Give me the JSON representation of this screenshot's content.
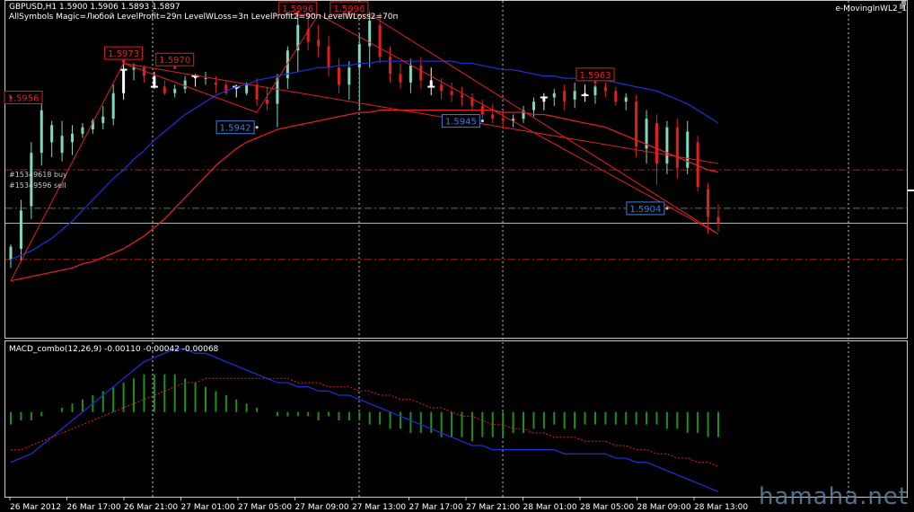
{
  "header": {
    "symbol_line": "GBPUSD,H1  1.5900 1.5906 1.5893 1.5897",
    "settings_line": "AllSymbols  Magic=Любой  LevelProfit=29п  LevelWLoss=3п  LevelProfit2=90п  LevelWLoss2=70п",
    "expert_name": "e-MovingInWL2_1"
  },
  "orders": [
    {
      "label": "#15349618 buy"
    },
    {
      "label": "#15349596 sell"
    }
  ],
  "watermark": "hamaha.net",
  "colors": {
    "bull_candle": "#7fd8c0",
    "bear_candle": "#e02020",
    "ma_fast": "#1a2fd0",
    "ma_slow": "#e02020",
    "zigzag": "#e02020",
    "macd_line": "#1a2fd0",
    "macd_signal": "#e02020",
    "macd_hist": "#1f8f1f",
    "high_label": "#e02020",
    "low_label": "#3a7fe0",
    "level_red": "#c01818",
    "level_green": "#3b8a3b",
    "level_grey": "#b0b0b0",
    "grid": "#c8c8c8"
  },
  "chart_data": [
    {
      "type": "candlestick",
      "title": "GBPUSD,H1",
      "ylim": [
        1.5845,
        1.6
      ],
      "x_tick_labels": [
        "26 Mar 2012",
        "26 Mar 17:00",
        "26 Mar 21:00",
        "27 Mar 01:00",
        "27 Mar 05:00",
        "27 Mar 09:00",
        "27 Mar 13:00",
        "27 Mar 17:00",
        "27 Mar 21:00",
        "28 Mar 01:00",
        "28 Mar 05:00",
        "28 Mar 09:00",
        "28 Mar 13:00"
      ],
      "candles": [
        {
          "o": 1.588,
          "h": 1.5887,
          "l": 1.5876,
          "c": 1.5886
        },
        {
          "o": 1.5885,
          "h": 1.5908,
          "l": 1.5879,
          "c": 1.5903
        },
        {
          "o": 1.5905,
          "h": 1.5935,
          "l": 1.5899,
          "c": 1.593
        },
        {
          "o": 1.593,
          "h": 1.5957,
          "l": 1.5924,
          "c": 1.595
        },
        {
          "o": 1.5935,
          "h": 1.5945,
          "l": 1.5928,
          "c": 1.5943
        },
        {
          "o": 1.593,
          "h": 1.5945,
          "l": 1.5926,
          "c": 1.5938
        },
        {
          "o": 1.5935,
          "h": 1.5943,
          "l": 1.5929,
          "c": 1.5939
        },
        {
          "o": 1.5939,
          "h": 1.5944,
          "l": 1.5937,
          "c": 1.5942
        },
        {
          "o": 1.5941,
          "h": 1.5946,
          "l": 1.5939,
          "c": 1.5945
        },
        {
          "o": 1.5944,
          "h": 1.5952,
          "l": 1.5941,
          "c": 1.5947
        },
        {
          "o": 1.5946,
          "h": 1.5962,
          "l": 1.5943,
          "c": 1.5958
        },
        {
          "o": 1.5958,
          "h": 1.5973,
          "l": 1.5955,
          "c": 1.5969
        },
        {
          "o": 1.5969,
          "h": 1.5972,
          "l": 1.5964,
          "c": 1.597
        },
        {
          "o": 1.597,
          "h": 1.5971,
          "l": 1.5963,
          "c": 1.5966
        },
        {
          "o": 1.5966,
          "h": 1.5968,
          "l": 1.596,
          "c": 1.5961
        },
        {
          "o": 1.5961,
          "h": 1.5964,
          "l": 1.5957,
          "c": 1.5958
        },
        {
          "o": 1.5958,
          "h": 1.5962,
          "l": 1.5956,
          "c": 1.596
        },
        {
          "o": 1.596,
          "h": 1.5966,
          "l": 1.5958,
          "c": 1.5964
        },
        {
          "o": 1.5965,
          "h": 1.5967,
          "l": 1.5961,
          "c": 1.5966
        },
        {
          "o": 1.5965,
          "h": 1.5968,
          "l": 1.5962,
          "c": 1.5965
        },
        {
          "o": 1.5963,
          "h": 1.5966,
          "l": 1.5958,
          "c": 1.5962
        },
        {
          "o": 1.5962,
          "h": 1.5964,
          "l": 1.5957,
          "c": 1.5958
        },
        {
          "o": 1.596,
          "h": 1.5962,
          "l": 1.5956,
          "c": 1.5961
        },
        {
          "o": 1.5958,
          "h": 1.5963,
          "l": 1.5957,
          "c": 1.5962
        },
        {
          "o": 1.5962,
          "h": 1.5965,
          "l": 1.5952,
          "c": 1.5955
        },
        {
          "o": 1.5955,
          "h": 1.5961,
          "l": 1.595,
          "c": 1.5953
        },
        {
          "o": 1.5953,
          "h": 1.5967,
          "l": 1.5942,
          "c": 1.5965
        },
        {
          "o": 1.5965,
          "h": 1.598,
          "l": 1.596,
          "c": 1.5978
        },
        {
          "o": 1.5978,
          "h": 1.5996,
          "l": 1.5968,
          "c": 1.599
        },
        {
          "o": 1.5988,
          "h": 1.5994,
          "l": 1.5978,
          "c": 1.5982
        },
        {
          "o": 1.5983,
          "h": 1.599,
          "l": 1.5975,
          "c": 1.598
        },
        {
          "o": 1.598,
          "h": 1.5985,
          "l": 1.5966,
          "c": 1.597
        },
        {
          "o": 1.597,
          "h": 1.5974,
          "l": 1.5958,
          "c": 1.5962
        },
        {
          "o": 1.5962,
          "h": 1.5973,
          "l": 1.5955,
          "c": 1.597
        },
        {
          "o": 1.597,
          "h": 1.5986,
          "l": 1.595,
          "c": 1.5981
        },
        {
          "o": 1.598,
          "h": 1.5996,
          "l": 1.597,
          "c": 1.5992
        },
        {
          "o": 1.599,
          "h": 1.5996,
          "l": 1.5972,
          "c": 1.5975
        },
        {
          "o": 1.5975,
          "h": 1.598,
          "l": 1.5963,
          "c": 1.5967
        },
        {
          "o": 1.5967,
          "h": 1.5972,
          "l": 1.596,
          "c": 1.5963
        },
        {
          "o": 1.5963,
          "h": 1.5974,
          "l": 1.5958,
          "c": 1.5971
        },
        {
          "o": 1.5971,
          "h": 1.5975,
          "l": 1.596,
          "c": 1.5964
        },
        {
          "o": 1.5964,
          "h": 1.597,
          "l": 1.5957,
          "c": 1.5961
        },
        {
          "o": 1.5962,
          "h": 1.5965,
          "l": 1.5955,
          "c": 1.5959
        },
        {
          "o": 1.5959,
          "h": 1.5963,
          "l": 1.5954,
          "c": 1.5957
        },
        {
          "o": 1.5957,
          "h": 1.5961,
          "l": 1.5952,
          "c": 1.5956
        },
        {
          "o": 1.5956,
          "h": 1.5958,
          "l": 1.595,
          "c": 1.5952
        },
        {
          "o": 1.5952,
          "h": 1.5955,
          "l": 1.5946,
          "c": 1.5948
        },
        {
          "o": 1.5948,
          "h": 1.5953,
          "l": 1.5944,
          "c": 1.5946
        },
        {
          "o": 1.5946,
          "h": 1.595,
          "l": 1.5941,
          "c": 1.5945
        },
        {
          "o": 1.5945,
          "h": 1.5948,
          "l": 1.5942,
          "c": 1.5946
        },
        {
          "o": 1.5946,
          "h": 1.5952,
          "l": 1.5944,
          "c": 1.595
        },
        {
          "o": 1.595,
          "h": 1.5956,
          "l": 1.5947,
          "c": 1.5954
        },
        {
          "o": 1.5954,
          "h": 1.5958,
          "l": 1.595,
          "c": 1.5956
        },
        {
          "o": 1.5956,
          "h": 1.596,
          "l": 1.5952,
          "c": 1.5958
        },
        {
          "o": 1.5959,
          "h": 1.5962,
          "l": 1.595,
          "c": 1.5954
        },
        {
          "o": 1.5955,
          "h": 1.5963,
          "l": 1.5951,
          "c": 1.5959
        },
        {
          "o": 1.5958,
          "h": 1.5962,
          "l": 1.5954,
          "c": 1.5957
        },
        {
          "o": 1.5957,
          "h": 1.5962,
          "l": 1.5953,
          "c": 1.5961
        },
        {
          "o": 1.5961,
          "h": 1.5963,
          "l": 1.5956,
          "c": 1.5959
        },
        {
          "o": 1.5959,
          "h": 1.5961,
          "l": 1.5952,
          "c": 1.5954
        },
        {
          "o": 1.5954,
          "h": 1.5958,
          "l": 1.595,
          "c": 1.5956
        },
        {
          "o": 1.5954,
          "h": 1.5957,
          "l": 1.5928,
          "c": 1.5933
        },
        {
          "o": 1.5932,
          "h": 1.595,
          "l": 1.5925,
          "c": 1.5946
        },
        {
          "o": 1.5944,
          "h": 1.5948,
          "l": 1.5915,
          "c": 1.5925
        },
        {
          "o": 1.5925,
          "h": 1.5945,
          "l": 1.592,
          "c": 1.5942
        },
        {
          "o": 1.5942,
          "h": 1.5946,
          "l": 1.5918,
          "c": 1.5923
        },
        {
          "o": 1.5923,
          "h": 1.5945,
          "l": 1.592,
          "c": 1.594
        },
        {
          "o": 1.5935,
          "h": 1.5938,
          "l": 1.5912,
          "c": 1.5914
        },
        {
          "o": 1.5913,
          "h": 1.5916,
          "l": 1.5892,
          "c": 1.59
        },
        {
          "o": 1.59,
          "h": 1.5906,
          "l": 1.5893,
          "c": 1.5897
        }
      ],
      "ma_fast": [
        1.588,
        1.5882,
        1.5884,
        1.5887,
        1.589,
        1.5894,
        1.5898,
        1.5903,
        1.5908,
        1.5913,
        1.5918,
        1.5922,
        1.5927,
        1.5931,
        1.5936,
        1.594,
        1.5944,
        1.5948,
        1.5951,
        1.5954,
        1.5957,
        1.5959,
        1.5961,
        1.5962,
        1.5964,
        1.5965,
        1.5966,
        1.5967,
        1.5968,
        1.5969,
        1.597,
        1.597,
        1.5971,
        1.5971,
        1.5972,
        1.5972,
        1.5973,
        1.5973,
        1.5973,
        1.5973,
        1.5973,
        1.5973,
        1.5973,
        1.5973,
        1.5972,
        1.5972,
        1.5971,
        1.597,
        1.5969,
        1.5969,
        1.5968,
        1.5967,
        1.5966,
        1.5966,
        1.5965,
        1.5965,
        1.5964,
        1.5964,
        1.5964,
        1.5963,
        1.5962,
        1.5961,
        1.596,
        1.5959,
        1.5957,
        1.5955,
        1.5953,
        1.595,
        1.5947,
        1.5944
      ],
      "ma_slow": [
        1.587,
        1.5871,
        1.5872,
        1.5873,
        1.5874,
        1.5875,
        1.5876,
        1.5878,
        1.5879,
        1.5881,
        1.5883,
        1.5885,
        1.5888,
        1.5891,
        1.5895,
        1.5899,
        1.5904,
        1.5909,
        1.5914,
        1.5919,
        1.5924,
        1.5928,
        1.5932,
        1.5935,
        1.5937,
        1.5939,
        1.5941,
        1.5942,
        1.5943,
        1.5944,
        1.5945,
        1.5946,
        1.5947,
        1.5948,
        1.5949,
        1.5949,
        1.595,
        1.595,
        1.595,
        1.595,
        1.595,
        1.595,
        1.595,
        1.595,
        1.595,
        1.595,
        1.595,
        1.595,
        1.5949,
        1.5949,
        1.5949,
        1.5948,
        1.5948,
        1.5947,
        1.5946,
        1.5945,
        1.5944,
        1.5943,
        1.5942,
        1.594,
        1.5938,
        1.5936,
        1.5934,
        1.5932,
        1.593,
        1.5928,
        1.5926,
        1.5924,
        1.5922,
        1.5921
      ],
      "zigzag": [
        {
          "i": 0,
          "p": 1.587
        },
        {
          "i": 11,
          "p": 1.5972
        },
        {
          "i": 24,
          "p": 1.5949
        },
        {
          "i": 30,
          "p": 1.5995
        },
        {
          "i": 69,
          "p": 1.5892
        }
      ],
      "trend_lines": [
        {
          "from": {
            "i": 11,
            "p": 1.5972
          },
          "to": {
            "i": 69,
            "p": 1.5925
          }
        },
        {
          "from": {
            "i": 35,
            "p": 1.5995
          },
          "to": {
            "i": 69,
            "p": 1.5892
          }
        }
      ],
      "price_labels": [
        {
          "text": "1.5956",
          "i": 0,
          "p": 1.5956,
          "kind": "high"
        },
        {
          "text": "1.5973",
          "i": 11,
          "p": 1.5973,
          "kind": "high"
        },
        {
          "text": "1.5970",
          "i": 16,
          "p": 1.597,
          "kind": "high"
        },
        {
          "text": "1.5942",
          "i": 24,
          "p": 1.5942,
          "kind": "low"
        },
        {
          "text": "1.5996",
          "i": 28,
          "p": 1.5996,
          "kind": "high"
        },
        {
          "text": "1.5996",
          "i": 33,
          "p": 1.5996,
          "kind": "high"
        },
        {
          "text": "1.5945",
          "i": 46,
          "p": 1.5945,
          "kind": "low"
        },
        {
          "text": "1.5963",
          "i": 57,
          "p": 1.5963,
          "kind": "high"
        },
        {
          "text": "1.5904",
          "i": 64,
          "p": 1.5904,
          "kind": "low"
        }
      ],
      "marker_bars": [
        11,
        14,
        18,
        22,
        41,
        52,
        56
      ],
      "levels": [
        {
          "p": 1.5922,
          "kind": "red-dashdot"
        },
        {
          "p": 1.5904,
          "kind": "green-dashdot"
        },
        {
          "p": 1.5897,
          "kind": "grey-solid"
        },
        {
          "p": 1.588,
          "kind": "red-dashdot"
        }
      ],
      "vertical_separators": [
        170,
        400,
        560,
        945
      ]
    },
    {
      "type": "bar",
      "title": "MACD_combo(12,26,9) -0.00110 -0.00042 -0.00068",
      "series": [
        {
          "name": "macd",
          "values": [
            -0.0012,
            -0.0011,
            -0.001,
            -0.0008,
            -0.0006,
            -0.0004,
            -0.0002,
            0.0,
            0.0002,
            0.0004,
            0.0006,
            0.0008,
            0.001,
            0.0012,
            0.0013,
            0.0014,
            0.0015,
            0.0015,
            0.0014,
            0.0014,
            0.0013,
            0.0012,
            0.0011,
            0.001,
            0.0009,
            0.0008,
            0.0007,
            0.0007,
            0.0006,
            0.0006,
            0.0005,
            0.0005,
            0.0004,
            0.0004,
            0.0003,
            0.0002,
            0.0001,
            0.0,
            -0.0001,
            -0.0002,
            -0.0003,
            -0.0004,
            -0.0005,
            -0.0006,
            -0.0007,
            -0.0008,
            -0.0008,
            -0.0009,
            -0.0009,
            -0.0009,
            -0.0009,
            -0.0009,
            -0.0009,
            -0.0009,
            -0.001,
            -0.001,
            -0.001,
            -0.001,
            -0.001,
            -0.0011,
            -0.0011,
            -0.0012,
            -0.0012,
            -0.0013,
            -0.0014,
            -0.0015,
            -0.0016,
            -0.0017,
            -0.0018,
            -0.0019
          ]
        },
        {
          "name": "signal",
          "values": [
            -0.0009,
            -0.0009,
            -0.0008,
            -0.0007,
            -0.0006,
            -0.0005,
            -0.0004,
            -0.0003,
            -0.0002,
            -0.0001,
            0.0,
            0.0001,
            0.0002,
            0.0003,
            0.0004,
            0.0005,
            0.0006,
            0.0007,
            0.0007,
            0.0008,
            0.0008,
            0.0008,
            0.0008,
            0.0008,
            0.0008,
            0.0008,
            0.0008,
            0.0008,
            0.0007,
            0.0007,
            0.0007,
            0.0006,
            0.0006,
            0.0006,
            0.0005,
            0.0005,
            0.0004,
            0.0004,
            0.0003,
            0.0003,
            0.0002,
            0.0001,
            0.0001,
            0.0,
            -0.0001,
            -0.0001,
            -0.0002,
            -0.0003,
            -0.0003,
            -0.0004,
            -0.0004,
            -0.0005,
            -0.0005,
            -0.0006,
            -0.0006,
            -0.0006,
            -0.0007,
            -0.0007,
            -0.0007,
            -0.0008,
            -0.0008,
            -0.0009,
            -0.0009,
            -0.001,
            -0.001,
            -0.0011,
            -0.0011,
            -0.0012,
            -0.0012,
            -0.0013
          ]
        },
        {
          "name": "histogram",
          "values": [
            -0.0003,
            -0.0002,
            -0.0002,
            -0.0001,
            0.0,
            0.0001,
            0.0002,
            0.0003,
            0.0004,
            0.0005,
            0.0006,
            0.0007,
            0.0008,
            0.0009,
            0.0009,
            0.0009,
            0.0009,
            0.0008,
            0.0007,
            0.0006,
            0.0005,
            0.0004,
            0.0003,
            0.0002,
            0.0001,
            0.0,
            -0.0001,
            -0.0001,
            -0.0001,
            -0.0001,
            -0.0002,
            -0.0001,
            -0.0002,
            -0.0002,
            -0.0002,
            -0.0003,
            -0.0003,
            -0.0004,
            -0.0004,
            -0.0005,
            -0.0005,
            -0.0005,
            -0.0006,
            -0.0006,
            -0.0006,
            -0.0007,
            -0.0006,
            -0.0006,
            -0.0006,
            -0.0005,
            -0.0005,
            -0.0004,
            -0.0004,
            -0.0003,
            -0.0004,
            -0.0004,
            -0.0003,
            -0.0003,
            -0.0003,
            -0.0003,
            -0.0003,
            -0.0003,
            -0.0003,
            -0.0003,
            -0.0004,
            -0.0004,
            -0.0005,
            -0.0005,
            -0.0006,
            -0.0006
          ]
        }
      ],
      "ylim": [
        -0.002,
        0.0016
      ]
    }
  ]
}
